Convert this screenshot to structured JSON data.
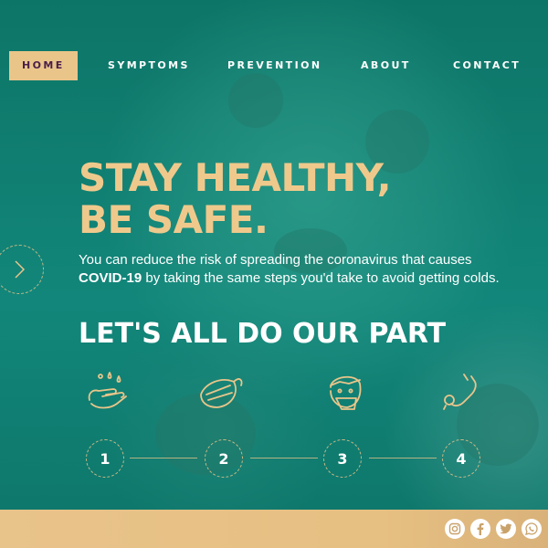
{
  "nav": {
    "items": [
      "HOME",
      "SYMPTOMS",
      "PREVENTION",
      "ABOUT",
      "CONTACT"
    ],
    "active": "HOME"
  },
  "hero": {
    "title_line1": "STAY HEALTHY,",
    "title_line2": "BE SAFE.",
    "subtitle_pre": "You can reduce the risk of spreading the coronavirus that causes",
    "subtitle_bold": "COVID-19",
    "subtitle_post": " by taking the same steps you'd take to avoid getting colds."
  },
  "section": {
    "title": "LET'S ALL DO OUR PART"
  },
  "steps": [
    {
      "number": "1",
      "icon": "handwashing-icon"
    },
    {
      "number": "2",
      "icon": "face-mask-icon"
    },
    {
      "number": "3",
      "icon": "sick-person-icon"
    },
    {
      "number": "4",
      "icon": "stethoscope-icon"
    }
  ],
  "social": [
    "instagram-icon",
    "facebook-icon",
    "twitter-icon",
    "whatsapp-icon"
  ],
  "colors": {
    "background": "#0f7a6e",
    "accent": "#eac58a",
    "active_text": "#4a1f4a",
    "text": "#ffffff"
  }
}
